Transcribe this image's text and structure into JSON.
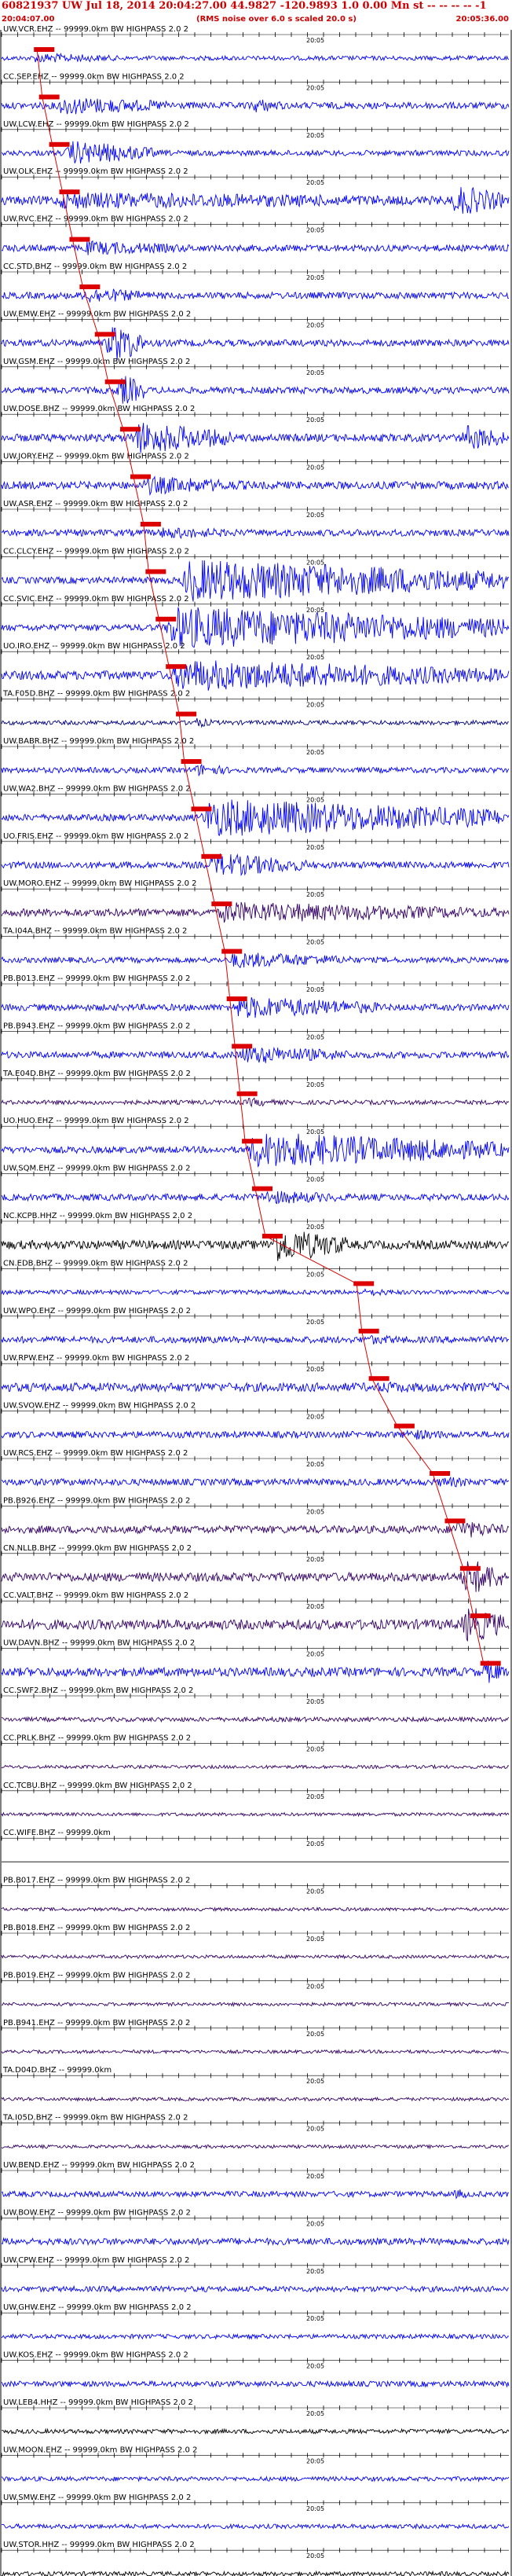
{
  "header": {
    "title": "60821937 UW Jul 18, 2014 20:04:27.00    44.9827 -120.9893  1.0 0.00 Mn st -- -- -- -- -1",
    "start_time": "20:04:07.00",
    "note": "(RMS noise over 6.0 s scaled 20.0 s)",
    "end_time": "20:05:36.00"
  },
  "time_marker": "20:05",
  "traces": [
    {
      "label": "UW.VCR.EHZ -- 99999.0km BW  HIGHPASS  2.0  2",
      "color": "#0000ff",
      "amp": 0.2,
      "pick": 0.07,
      "burst": [
        {
          "s": 0.05,
          "e": 0.25,
          "a": 0.5
        }
      ]
    },
    {
      "label": "CC.SEP.EHZ -- 99999.0km BW  HIGHPASS  2.0  2",
      "color": "#0000ff",
      "amp": 0.3,
      "pick": 0.08,
      "burst": [
        {
          "s": 0.1,
          "e": 0.35,
          "a": 0.9
        },
        {
          "s": 0.48,
          "e": 0.56,
          "a": 0.8
        }
      ]
    },
    {
      "label": "UW.LCW.EHZ -- 99999.0km BW  HIGHPASS  2.0  2",
      "color": "#0000ff",
      "amp": 0.25,
      "pick": 0.1,
      "burst": [
        {
          "s": 0.12,
          "e": 0.3,
          "a": 1.2
        }
      ]
    },
    {
      "label": "UW.OLK.EHZ -- 99999.0km BW  HIGHPASS  2.0  2",
      "color": "#0000ff",
      "amp": 0.4,
      "pick": 0.12,
      "burst": [
        {
          "s": 0.1,
          "e": 1.0,
          "a": 0.8
        },
        {
          "s": 0.88,
          "e": 0.99,
          "a": 1.6
        }
      ]
    },
    {
      "label": "UW.RVC.EHZ -- 99999.0km BW  HIGHPASS  2.0  2",
      "color": "#0000ff",
      "amp": 0.3,
      "pick": 0.14,
      "burst": [
        {
          "s": 0.15,
          "e": 0.4,
          "a": 0.7
        }
      ]
    },
    {
      "label": "CC.STD.BHZ -- 99999.0km BW  HIGHPASS  2.0  2",
      "color": "#0000ff",
      "amp": 0.3,
      "pick": 0.16,
      "burst": [
        {
          "s": 0.15,
          "e": 0.3,
          "a": 0.8
        }
      ]
    },
    {
      "label": "UW.EMW.EHZ -- 99999.0km BW  HIGHPASS  2.0  2",
      "color": "#0000ff",
      "amp": 0.3,
      "pick": 0.19,
      "burst": [
        {
          "s": 0.2,
          "e": 0.28,
          "a": 2.2
        }
      ]
    },
    {
      "label": "UW.GSM.EHZ -- 99999.0km BW  HIGHPASS  2.0  2",
      "color": "#0000ff",
      "amp": 0.3,
      "pick": 0.21,
      "burst": [
        {
          "s": 0.22,
          "e": 0.28,
          "a": 1.8
        }
      ]
    },
    {
      "label": "UW.DOSE.BHZ -- 99999.0km BW  HIGHPASS  2.0  2",
      "color": "#0000ff",
      "amp": 0.35,
      "pick": 0.24,
      "burst": [
        {
          "s": 0.25,
          "e": 0.45,
          "a": 1.6
        },
        {
          "s": 0.9,
          "e": 0.99,
          "a": 1.4
        }
      ]
    },
    {
      "label": "UW.JORY.EHZ -- 99999.0km BW  HIGHPASS  2.0  2",
      "color": "#0000ff",
      "amp": 0.35,
      "pick": 0.26,
      "burst": [
        {
          "s": 0.27,
          "e": 0.5,
          "a": 0.9
        }
      ]
    },
    {
      "label": "UW.ASR.EHZ -- 99999.0km BW  HIGHPASS  2.0  2",
      "color": "#0000ff",
      "amp": 0.3,
      "pick": 0.28,
      "burst": [
        {
          "s": 0.3,
          "e": 0.5,
          "a": 0.6
        }
      ]
    },
    {
      "label": "CC.CLCY.EHZ -- 99999.0km BW  HIGHPASS  2.0  2",
      "color": "#0000ff",
      "amp": 0.3,
      "pick": 0.29,
      "burst": [
        {
          "s": 0.35,
          "e": 0.99,
          "a": 2.0
        }
      ]
    },
    {
      "label": "CC.SVIC.EHZ -- 99999.0km BW  HIGHPASS  2.0  2",
      "color": "#0000ff",
      "amp": 0.3,
      "pick": 0.31,
      "burst": [
        {
          "s": 0.32,
          "e": 0.99,
          "a": 2.0
        }
      ]
    },
    {
      "label": "UO.IRO.EHZ -- 99999.0km BW  HIGHPASS  2.0  2",
      "color": "#0000ff",
      "amp": 0.4,
      "pick": 0.33,
      "burst": [
        {
          "s": 0.33,
          "e": 0.99,
          "a": 1.5
        }
      ]
    },
    {
      "label": "TA.F05D.BHZ -- 99999.0km BW  HIGHPASS  2.0  2",
      "color": "#000080",
      "amp": 0.2,
      "pick": 0.35,
      "burst": [
        {
          "s": 0.36,
          "e": 0.42,
          "a": 0.6
        }
      ]
    },
    {
      "label": "UW.BABR.BHZ -- 99999.0km BW  HIGHPASS  2.0  2",
      "color": "#0000ff",
      "amp": 0.25,
      "pick": 0.36,
      "burst": [
        {
          "s": 0.37,
          "e": 0.45,
          "a": 0.7
        }
      ]
    },
    {
      "label": "UW.WA2.BHZ -- 99999.0km BW  HIGHPASS  2.0  2",
      "color": "#0000ff",
      "amp": 0.3,
      "pick": 0.38,
      "burst": [
        {
          "s": 0.39,
          "e": 0.99,
          "a": 1.8
        }
      ]
    },
    {
      "label": "UO.FRIS.EHZ -- 99999.0km BW  HIGHPASS  2.0  2",
      "color": "#0000ff",
      "amp": 0.3,
      "pick": 0.4,
      "burst": [
        {
          "s": 0.4,
          "e": 0.6,
          "a": 1.2
        }
      ]
    },
    {
      "label": "UW.MORO.EHZ -- 99999.0km BW  HIGHPASS  2.0  2",
      "color": "#330066",
      "amp": 0.35,
      "pick": 0.42,
      "burst": [
        {
          "s": 0.42,
          "e": 0.99,
          "a": 1.0
        }
      ]
    },
    {
      "label": "TA.I04A.BHZ -- 99999.0km BW  HIGHPASS  2.0  2",
      "color": "#0000ff",
      "amp": 0.25,
      "pick": 0.44,
      "burst": [
        {
          "s": 0.44,
          "e": 0.7,
          "a": 0.8
        }
      ]
    },
    {
      "label": "PB.B013.EHZ -- 99999.0km BW  HIGHPASS  2.0  2",
      "color": "#0000ff",
      "amp": 0.3,
      "pick": 0.45,
      "burst": [
        {
          "s": 0.45,
          "e": 0.75,
          "a": 1.1
        }
      ]
    },
    {
      "label": "PB.B943.EHZ -- 99999.0km BW  HIGHPASS  2.0  2",
      "color": "#0000ff",
      "amp": 0.3,
      "pick": 0.46,
      "burst": [
        {
          "s": 0.46,
          "e": 0.7,
          "a": 0.9
        }
      ]
    },
    {
      "label": "TA.E04D.BHZ -- 99999.0km BW  HIGHPASS  2.0  2",
      "color": "#330066",
      "amp": 0.2,
      "pick": 0.47,
      "burst": [
        {
          "s": 0.47,
          "e": 0.55,
          "a": 0.5
        }
      ]
    },
    {
      "label": "UO.HUO.EHZ -- 99999.0km BW  HIGHPASS  2.0  2",
      "color": "#0000ff",
      "amp": 0.3,
      "pick": 0.48,
      "burst": [
        {
          "s": 0.48,
          "e": 0.99,
          "a": 1.7
        }
      ]
    },
    {
      "label": "UW.SQM.EHZ -- 99999.0km BW  HIGHPASS  2.0  2",
      "color": "#0000ff",
      "amp": 0.3,
      "pick": 0.5,
      "burst": [
        {
          "s": 0.5,
          "e": 0.7,
          "a": 0.7
        }
      ]
    },
    {
      "label": "NC.KCPB.HHZ -- 99999.0km BW  HIGHPASS  2.0  2",
      "color": "#000000",
      "amp": 0.4,
      "pick": 0.52,
      "burst": [
        {
          "s": 0.52,
          "e": 0.68,
          "a": 1.8
        }
      ]
    },
    {
      "label": "CN.EDB.BHZ -- 99999.0km BW  HIGHPASS  2.0  2",
      "color": "#0000ff",
      "amp": 0.2,
      "pick": 0.7,
      "burst": [
        {
          "s": 0.7,
          "e": 0.8,
          "a": 0.4
        }
      ]
    },
    {
      "label": "UW.WPO.EHZ -- 99999.0km BW  HIGHPASS  2.0  2",
      "color": "#0000ff",
      "amp": 0.3,
      "pick": 0.71,
      "burst": [
        {
          "s": 0.7,
          "e": 0.85,
          "a": 0.5
        }
      ]
    },
    {
      "label": "UW.RPW.EHZ -- 99999.0km BW  HIGHPASS  2.0  2",
      "color": "#0000ff",
      "amp": 0.4,
      "pick": 0.73,
      "burst": [
        {
          "s": 0.73,
          "e": 0.9,
          "a": 0.6
        }
      ]
    },
    {
      "label": "UW.SVOW.EHZ -- 99999.0km BW  HIGHPASS  2.0  2",
      "color": "#0000ff",
      "amp": 0.3,
      "pick": 0.78,
      "burst": [
        {
          "s": 0.78,
          "e": 0.9,
          "a": 0.6
        }
      ]
    },
    {
      "label": "UW.RCS.EHZ -- 99999.0km BW  HIGHPASS  2.0  2",
      "color": "#0000ff",
      "amp": 0.3,
      "pick": 0.85,
      "burst": [
        {
          "s": 0.85,
          "e": 0.95,
          "a": 0.6
        }
      ]
    },
    {
      "label": "PB.B926.EHZ -- 99999.0km BW  HIGHPASS  2.0  2",
      "color": "#330066",
      "amp": 0.35,
      "pick": 0.88,
      "burst": [
        {
          "s": 0.88,
          "e": 0.99,
          "a": 1.0
        }
      ]
    },
    {
      "label": "CN.NLLB.BHZ -- 99999.0km BW  HIGHPASS  2.0  2",
      "color": "#330066",
      "amp": 0.4,
      "pick": 0.91,
      "burst": [
        {
          "s": 0.9,
          "e": 0.99,
          "a": 2.0
        }
      ]
    },
    {
      "label": "CC.VALT.BHZ -- 99999.0km BW  HIGHPASS  2.0  2",
      "color": "#330066",
      "amp": 0.45,
      "pick": 0.93,
      "burst": [
        {
          "s": 0.9,
          "e": 0.99,
          "a": 2.0
        }
      ]
    },
    {
      "label": "UW.DAVN.BHZ -- 99999.0km BW  HIGHPASS  2.0  2",
      "color": "#0000ff",
      "amp": 0.4,
      "pick": 0.95,
      "burst": [
        {
          "s": 0.94,
          "e": 0.99,
          "a": 1.4
        }
      ]
    },
    {
      "label": "CC.SWF2.BHZ -- 99999.0km BW  HIGHPASS  2.0  2",
      "color": "#330066",
      "amp": 0.2,
      "pick": null,
      "burst": []
    },
    {
      "label": "CC.PRLK.BHZ -- 99999.0km BW  HIGHPASS  2.0  2",
      "color": "#330066",
      "amp": 0.15,
      "pick": null,
      "burst": []
    },
    {
      "label": "CC.TCBU.BHZ -- 99999.0km BW  HIGHPASS  2.0  2",
      "color": "#330066",
      "amp": 0.15,
      "pick": null,
      "burst": []
    },
    {
      "label": "CC.WIFE.BHZ -- 99999.0km",
      "color": "#000000",
      "amp": 0.0,
      "pick": null,
      "burst": []
    },
    {
      "label": "PB.B017.EHZ -- 99999.0km BW  HIGHPASS  2.0  2",
      "color": "#330066",
      "amp": 0.15,
      "pick": null,
      "burst": []
    },
    {
      "label": "PB.B018.EHZ -- 99999.0km BW  HIGHPASS  2.0  2",
      "color": "#330066",
      "amp": 0.15,
      "pick": null,
      "burst": []
    },
    {
      "label": "PB.B019.EHZ -- 99999.0km BW  HIGHPASS  2.0  2",
      "color": "#330066",
      "amp": 0.15,
      "pick": null,
      "burst": []
    },
    {
      "label": "PB.B941.EHZ -- 99999.0km BW  HIGHPASS  2.0  2",
      "color": "#330066",
      "amp": 0.15,
      "pick": null,
      "burst": []
    },
    {
      "label": "TA.D04D.BHZ -- 99999.0km",
      "color": "#330066",
      "amp": 0.15,
      "pick": null,
      "burst": []
    },
    {
      "label": "TA.I05D.BHZ -- 99999.0km BW  HIGHPASS  2.0  2",
      "color": "#330066",
      "amp": 0.15,
      "pick": null,
      "burst": []
    },
    {
      "label": "UW.BEND.EHZ -- 99999.0km BW  HIGHPASS  2.0  2",
      "color": "#0000ff",
      "amp": 0.25,
      "pick": null,
      "burst": [
        {
          "s": 0.88,
          "e": 0.92,
          "a": 0.6
        }
      ]
    },
    {
      "label": "UW.BOW.EHZ -- 99999.0km BW  HIGHPASS  2.0  2",
      "color": "#0000ff",
      "amp": 0.3,
      "pick": null,
      "burst": []
    },
    {
      "label": "UW.CPW.EHZ -- 99999.0km BW  HIGHPASS  2.0  2",
      "color": "#0000ff",
      "amp": 0.25,
      "pick": null,
      "burst": []
    },
    {
      "label": "UW.GHW.EHZ -- 99999.0km BW  HIGHPASS  2.0  2",
      "color": "#0000ff",
      "amp": 0.2,
      "pick": null,
      "burst": []
    },
    {
      "label": "UW.KOS.EHZ -- 99999.0km BW  HIGHPASS  2.0  2",
      "color": "#0000ff",
      "amp": 0.25,
      "pick": null,
      "burst": []
    },
    {
      "label": "UW.LEB4.HHZ -- 99999.0km BW  HIGHPASS  2.0  2",
      "color": "#000000",
      "amp": 0.2,
      "pick": null,
      "burst": []
    },
    {
      "label": "UW.MOON.EHZ -- 99999.0km BW  HIGHPASS  2.0  2",
      "color": "#0000ff",
      "amp": 0.2,
      "pick": null,
      "burst": []
    },
    {
      "label": "UW.SMW.EHZ -- 99999.0km BW  HIGHPASS  2.0  2",
      "color": "#0000ff",
      "amp": 0.2,
      "pick": null,
      "burst": []
    },
    {
      "label": "UW.STOR.HHZ -- 99999.0km BW  HIGHPASS  2.0  2",
      "color": "#000000",
      "amp": 0.2,
      "pick": null,
      "burst": []
    }
  ]
}
